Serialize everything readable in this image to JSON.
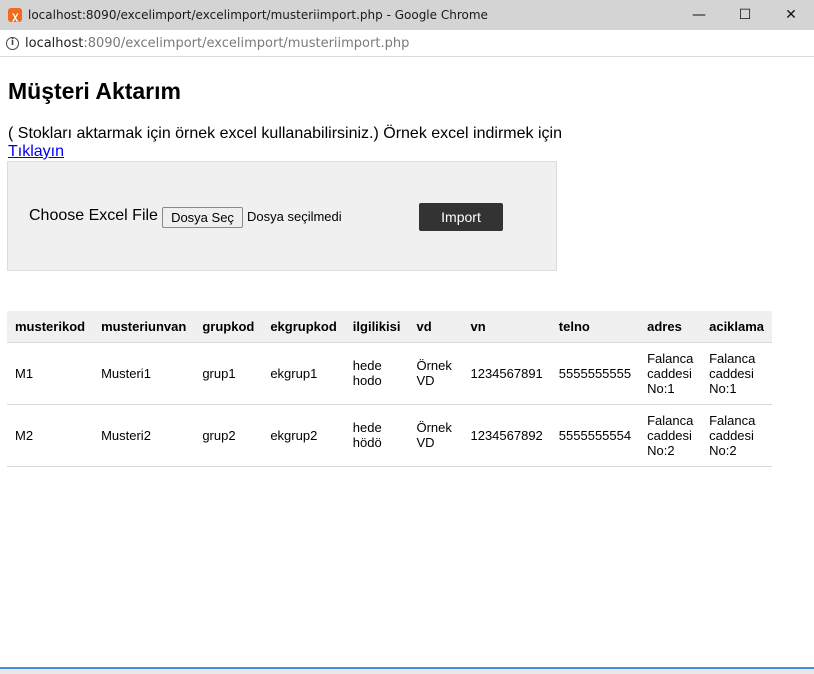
{
  "window": {
    "title": "localhost:8090/excelimport/excelimport/musteriimport.php - Google Chrome",
    "controls": {
      "minimize": "—",
      "maximize": "☐",
      "close": "✕"
    },
    "app_icon": "xampp-icon"
  },
  "address": {
    "host": "localhost",
    "path": ":8090/excelimport/excelimport/musteriimport.php",
    "icon": "info-icon"
  },
  "page": {
    "title": "Müşteri Aktarım",
    "intro_text": "( Stokları aktarmak için örnek excel kullanabilirsiniz.) Örnek excel indirmek için ",
    "intro_link": "Tıklayın"
  },
  "upload": {
    "label": "Choose Excel File",
    "file_button": "Dosya Seç",
    "file_status": "Dosya seçilmedi",
    "import_button": "Import"
  },
  "table": {
    "headers": [
      "musterikod",
      "musteriunvan",
      "grupkod",
      "ekgrupkod",
      "ilgilikisi",
      "vd",
      "vn",
      "telno",
      "adres",
      "aciklama"
    ],
    "rows": [
      [
        "M1",
        "Musteri1",
        "grup1",
        "ekgrup1",
        "hede hodo",
        "Örnek VD",
        "1234567891",
        "5555555555",
        "Falanca caddesi No:1",
        "Falanca caddesi No:1"
      ],
      [
        "M2",
        "Musteri2",
        "grup2",
        "ekgrup2",
        "hede hödö",
        "Örnek VD",
        "1234567892",
        "5555555554",
        "Falanca caddesi No:2",
        "Falanca caddesi No:2"
      ]
    ]
  },
  "colors": {
    "import_button_bg": "#333333",
    "panel_bg": "#f0f0f0",
    "link": "#0000ee"
  }
}
